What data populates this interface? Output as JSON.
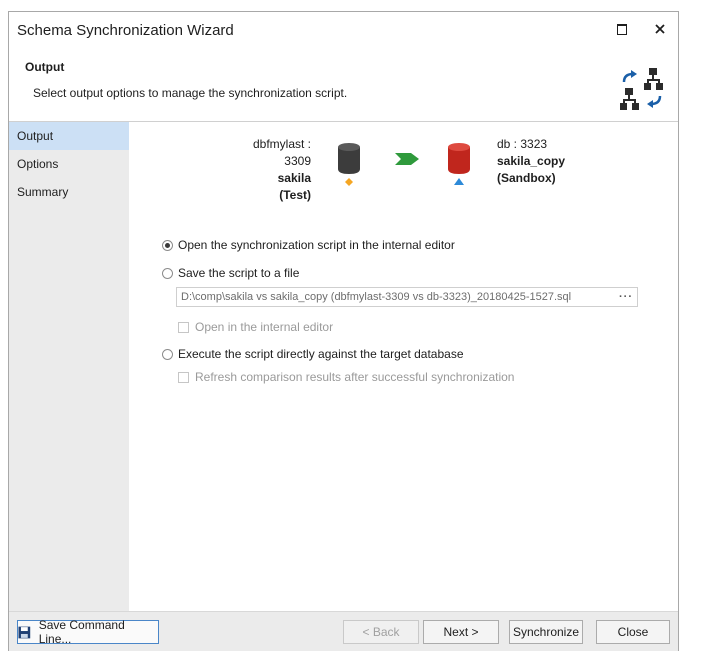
{
  "window": {
    "title": "Schema Synchronization Wizard"
  },
  "header": {
    "title": "Output",
    "description": "Select output options to manage the synchronization script."
  },
  "sidebar": {
    "items": [
      {
        "label": "Output"
      },
      {
        "label": "Options"
      },
      {
        "label": "Summary"
      }
    ]
  },
  "source": {
    "connection": "dbfmylast : 3309",
    "database": "sakila",
    "environment": "(Test)",
    "color": "#3c3c3c",
    "marker_color": "#f5a623"
  },
  "target": {
    "connection": "db : 3323",
    "database": "sakila_copy",
    "environment": "(Sandbox)",
    "color": "#c0261d",
    "marker_color": "#2d8ad8"
  },
  "options": {
    "open_editor": "Open the synchronization script in the internal editor",
    "save_file": "Save the script to a file",
    "file_path": "D:\\comp\\sakila vs sakila_copy (dbfmylast-3309 vs db-3323)_20180425-1527.sql",
    "browse_label": "···",
    "open_in_editor": "Open in the internal editor",
    "execute_directly": "Execute the script directly against the target database",
    "refresh_results": "Refresh comparison results after successful synchronization",
    "selected": "open_editor"
  },
  "footer": {
    "save_command_line": "Save Command Line...",
    "back": "< Back",
    "next": "Next >",
    "synchronize": "Synchronize",
    "close": "Close"
  },
  "colors": {
    "accent": "#cce0f5",
    "arrow": "#2f9a3c",
    "icon_blue": "#1a5fa8"
  }
}
